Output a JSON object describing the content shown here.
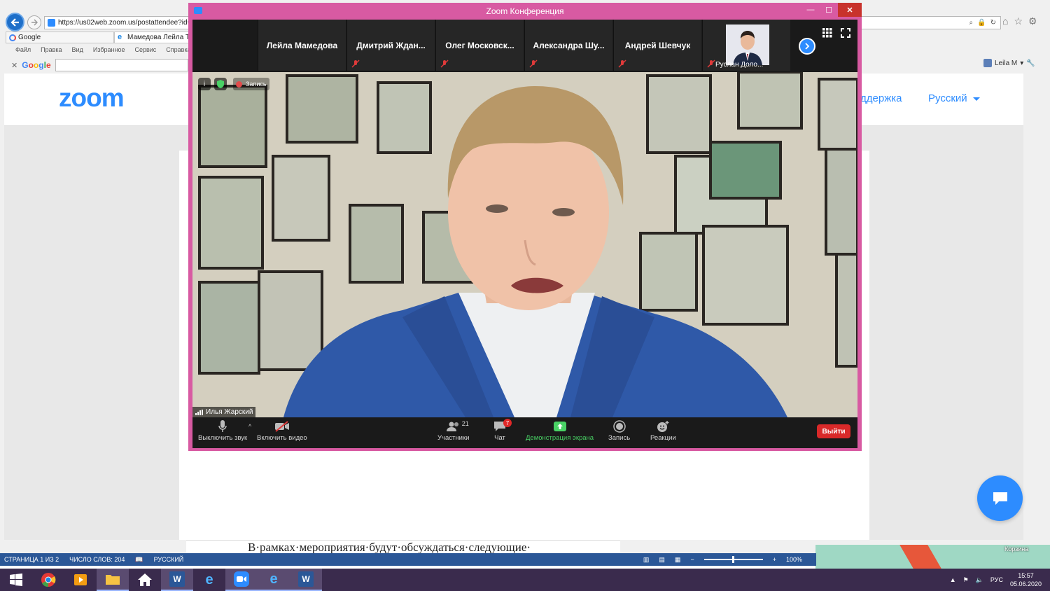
{
  "browser": {
    "address": "https://us02web.zoom.us/postattendee?id=1",
    "tabs": [
      {
        "label": "Google"
      },
      {
        "label": "Мамедова Лейла То"
      }
    ],
    "menu": [
      "Файл",
      "Правка",
      "Вид",
      "Избранное",
      "Сервис",
      "Справка"
    ],
    "google_label": "Google",
    "user": "Leila M"
  },
  "site": {
    "logo": "zoom",
    "nav_support": "оддержка",
    "nav_language": "Русский"
  },
  "zoom_window": {
    "title": "Zoom Конференция",
    "participants_strip": [
      {
        "name": "Лейла Мамедова",
        "muted": false
      },
      {
        "name": "Дмитрий  Ждан...",
        "muted": true
      },
      {
        "name": "Олег  Московск...",
        "muted": true
      },
      {
        "name": "Александра  Шу...",
        "muted": true
      },
      {
        "name": "Андрей Шевчук",
        "muted": true
      },
      {
        "name": "Руслан Доло...",
        "muted": true,
        "has_photo": true
      }
    ],
    "record_indicator": "Запись",
    "active_speaker": "Илья Жарский",
    "toolbar": {
      "mute": "Выключить звук",
      "video": "Включить видео",
      "participants": "Участники",
      "participants_count": "21",
      "chat": "Чат",
      "chat_badge": "7",
      "share": "Демонстрация экрана",
      "record": "Запись",
      "reactions": "Реакции",
      "leave": "Выйти"
    }
  },
  "word": {
    "doc_text": "В·рамках·мероприятия·будут·обсуждаться·следующие·",
    "status_page": "СТРАНИЦА 1 ИЗ 2",
    "status_words": "ЧИСЛО СЛОВ: 204",
    "status_lang": "РУССКИЙ",
    "zoom_level": "100%"
  },
  "desktop": {
    "recycle_bin": "Корзина"
  },
  "taskbar": {
    "lang": "РУС",
    "time": "15:57",
    "date": "05.06.2020"
  }
}
